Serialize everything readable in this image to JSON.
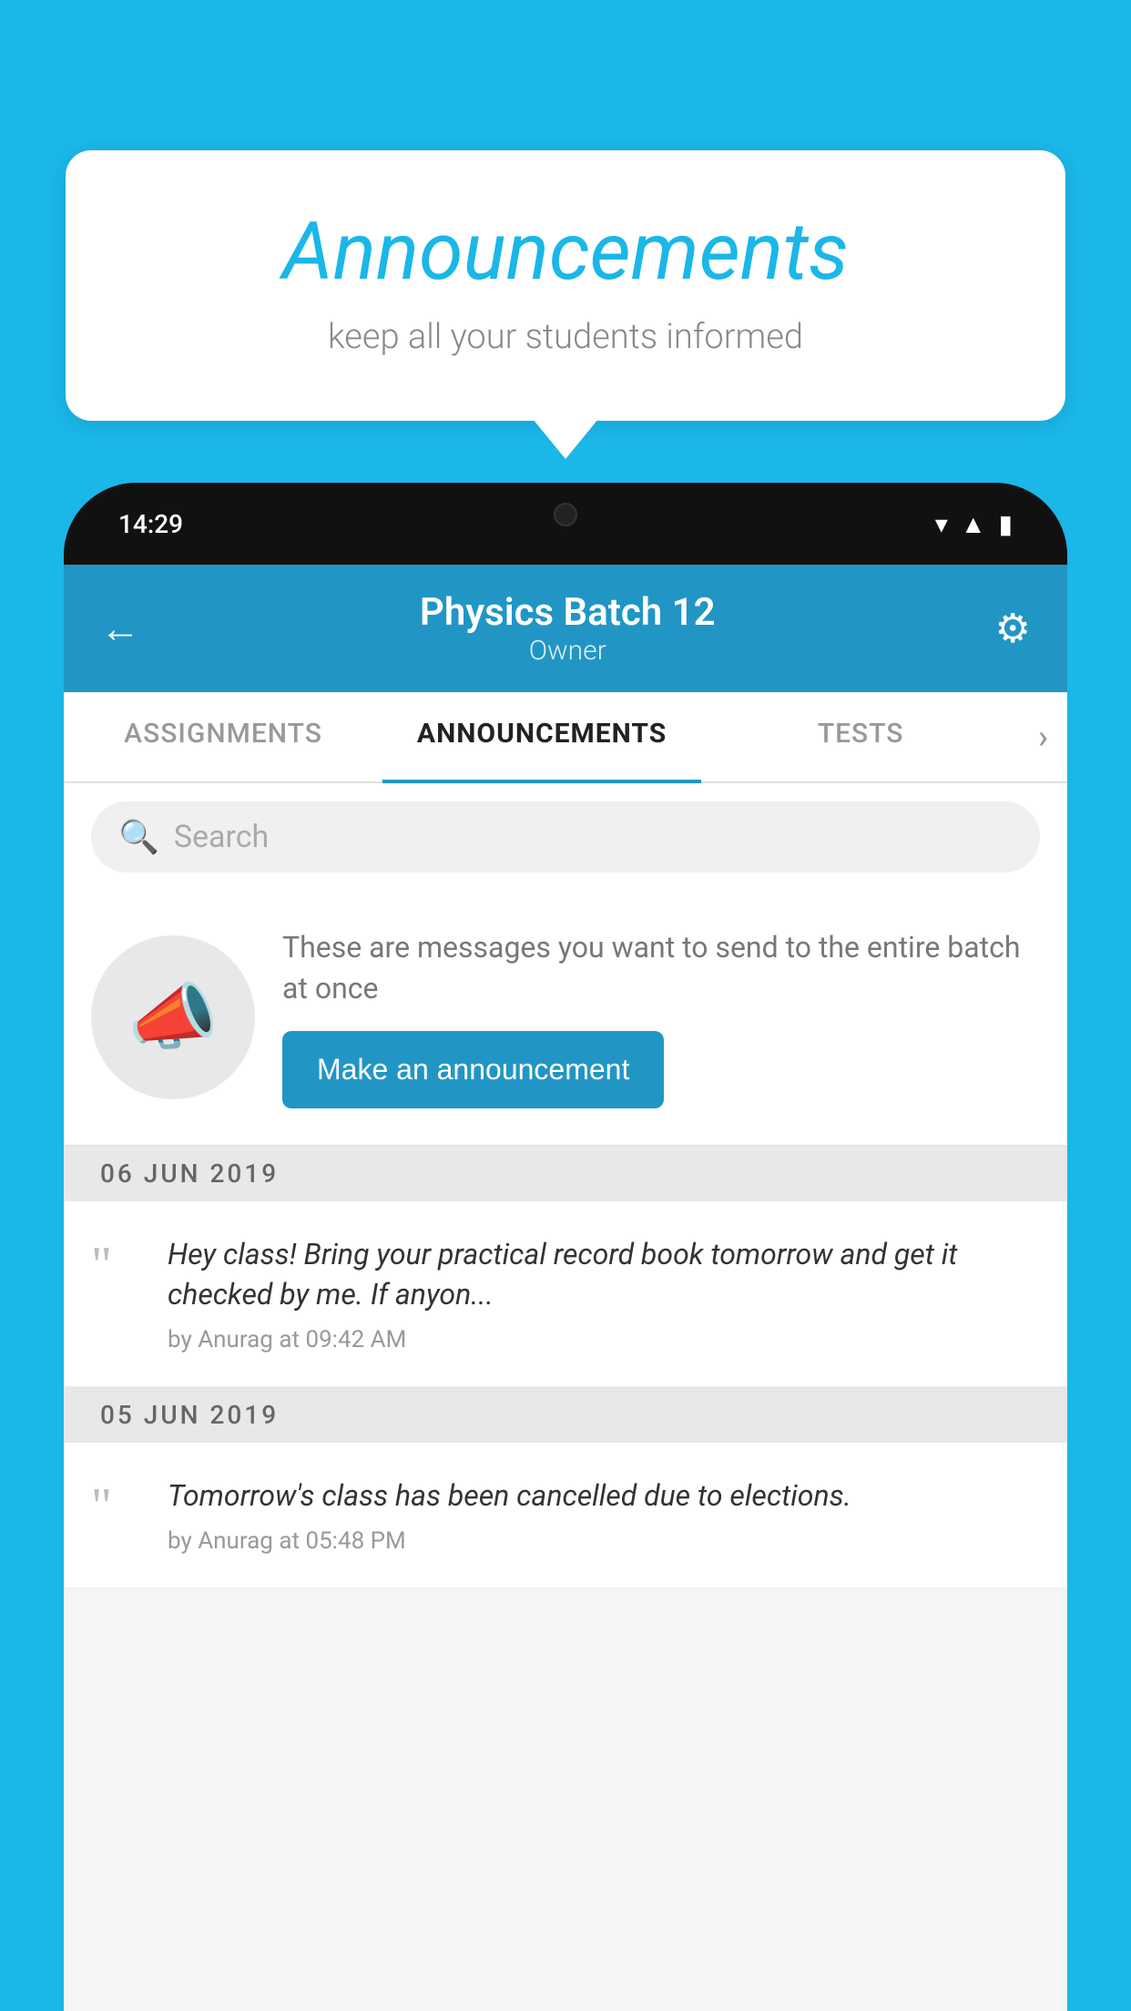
{
  "background": {
    "color": "#1ab7e8"
  },
  "card": {
    "title": "Announcements",
    "subtitle": "keep all your students informed"
  },
  "phone": {
    "status_bar": {
      "time": "14:29",
      "wifi": "▾",
      "signal": "▲",
      "battery": "▮"
    },
    "header": {
      "title": "Physics Batch 12",
      "subtitle": "Owner",
      "back_label": "←",
      "gear_label": "⚙"
    },
    "tabs": [
      {
        "label": "ASSIGNMENTS",
        "active": false
      },
      {
        "label": "ANNOUNCEMENTS",
        "active": true
      },
      {
        "label": "TESTS",
        "active": false
      },
      {
        "label": "›",
        "active": false
      }
    ],
    "search": {
      "placeholder": "Search"
    },
    "intro": {
      "text": "These are messages you want to send to the entire batch at once",
      "button_label": "Make an announcement"
    },
    "announcements": [
      {
        "date": "06  JUN  2019",
        "text": "Hey class! Bring your practical record book tomorrow and get it checked by me. If anyon...",
        "meta": "by Anurag at 09:42 AM"
      },
      {
        "date": "05  JUN  2019",
        "text": "Tomorrow's class has been cancelled due to elections.",
        "meta": "by Anurag at 05:48 PM"
      }
    ]
  }
}
